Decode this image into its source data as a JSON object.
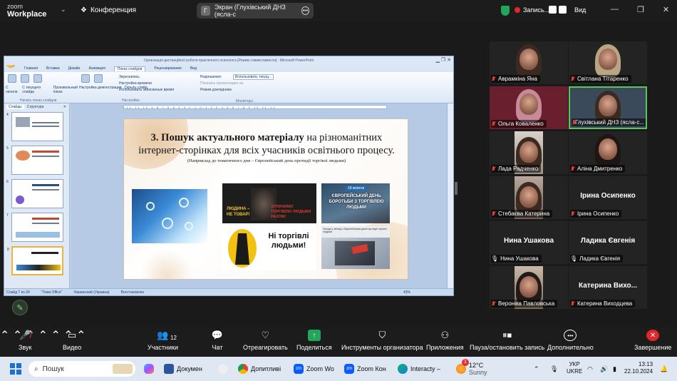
{
  "app": {
    "logo_line1": "zoom",
    "logo_line2": "Workplace",
    "conference_label": "Конференция"
  },
  "screen_share": {
    "badge": "Г",
    "title": "Экран (Глухівський ДНЗ (ясла-с"
  },
  "recording": {
    "label": "Запись..."
  },
  "view_label": "Вид",
  "powerpoint": {
    "title": "Організація дистанційної роботи практичного психолога [Режим совместимости] - Microsoft PowerPoint",
    "tabs": [
      "Главная",
      "Вставка",
      "Дизайн",
      "Анимация",
      "Показ слайдов",
      "Рецензирование",
      "Вид"
    ],
    "active_tab": "Показ слайдов",
    "ribbon": {
      "btn1": "С начала",
      "btn2": "С текущего слайда",
      "btn3": "Произвольный показ",
      "grp1": "Начать показ слайдов",
      "btn4": "Настройка демонстрации",
      "btn5": "Скрыть слайд",
      "opt1": "Звукозапись",
      "opt2": "Настройка времени",
      "opt3": "Использовать записанные время",
      "grp2": "Настройка",
      "mon1": "Разрешение:",
      "mon1_val": "Использовать текущ...",
      "mon2": "Показать презентацию на:",
      "mon3": "Режим докладчика",
      "grp3": "Мониторы"
    },
    "pane_tabs": [
      "Слайды",
      "Структура"
    ],
    "thumbs": [
      "4",
      "5",
      "6",
      "7",
      "8"
    ],
    "status": {
      "slide": "Слайд 7 из 30",
      "theme": "\"Тема Office\"",
      "lang": "Украинский (Украина)",
      "state": "Восстановлен",
      "zoom": "43%"
    }
  },
  "slide": {
    "title_bold": "3. Пошук актуального матеріалу",
    "title_rest": " на різноманітних",
    "title_line2": "інтернет-сторінках  для всіх учасників освітнього процесу.",
    "subtitle": "(Наприклад до тематичного дня – Європейський день протидії торгівлі людьми)",
    "img2_left_a": "ЛЮДИНА –",
    "img2_left_b": "НЕ ТОВАР!",
    "img2_right": "ЗУПИНИМО ТОРГІВЛЮ ЛЮДЬМИ РАЗОМ!",
    "img3_badge": "18 жовтня",
    "img3_text": "ЄВРОПЕЙСЬКИЙ ДЕНЬ БОРОТЬБИ З ТОРГІВЛЕЮ ЛЮДЬМИ",
    "img4_text": "Ні торгівлі людьми!",
    "img5_head": "Заходи у зв'язку з Європейським днем протидії торгівлі людьми"
  },
  "participants": [
    {
      "name": "Аврамкіна Яна",
      "muted": true
    },
    {
      "name": "Світлана Тітаренко",
      "muted": true
    },
    {
      "name": "Ольга Коваленко",
      "muted": true
    },
    {
      "name": "Глухівський ДНЗ (ясла-с...",
      "muted": true
    },
    {
      "name": "Лада Радченко",
      "muted": true
    },
    {
      "name": "Аліна Дмитренко",
      "muted": true
    },
    {
      "name": "Стебаєва Катерина",
      "muted": true
    },
    {
      "name": "Ірина Осипенко",
      "muted": true,
      "big": "Ірина Осипенко"
    },
    {
      "name": "Нина Ушакова",
      "muted": false,
      "big": "Нина Ушакова"
    },
    {
      "name": "Ладика Євгенія",
      "muted": false,
      "big": "Ладика Євгенія"
    },
    {
      "name": "Вероніка Павловська",
      "muted": true
    },
    {
      "name": "Катерина Виходцева",
      "muted": true,
      "big": "Катерина  Вихо..."
    }
  ],
  "toolbar": {
    "audio": "Звук",
    "video": "Видео",
    "participants": "Участники",
    "participants_count": "12",
    "chat": "Чат",
    "react": "Отреагировать",
    "share": "Поделиться",
    "host_tools": "Инструменты организатора",
    "apps": "Приложения",
    "pause_rec": "Пауза/остановить запись",
    "more": "Дополнительно",
    "end": "Завершение"
  },
  "taskbar": {
    "search": "Пошук",
    "apps": [
      "Докумен",
      "Допитливі",
      "Zoom Wo",
      "Zoom Кон",
      "Interacty –"
    ],
    "weather_temp": "12°C",
    "weather_desc": "Sunny",
    "weather_badge": "1",
    "lang1": "УКР",
    "lang2": "UKRE",
    "time": "13:13",
    "date": "22.10.2024"
  }
}
